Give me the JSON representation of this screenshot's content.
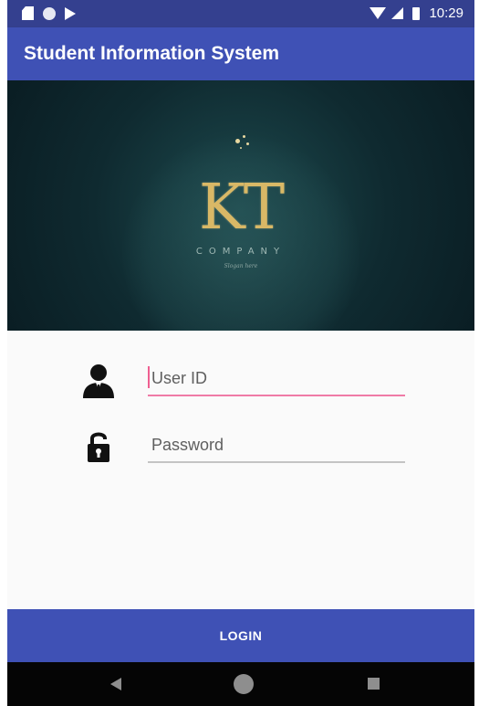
{
  "status_bar": {
    "time": "10:29",
    "icons": [
      "sd-card-icon",
      "circle-notification-icon",
      "play-store-icon",
      "wifi-icon",
      "cell-signal-icon",
      "battery-icon"
    ]
  },
  "app_bar": {
    "title": "Student Information System",
    "color": "#3f51b5"
  },
  "banner": {
    "logo_text": "KT",
    "company_text": "COMPANY",
    "slogan_text": "Slogan here",
    "logo_color": "#d9b866",
    "background_color": "#0f2a30"
  },
  "form": {
    "user_id": {
      "icon": "person-icon",
      "placeholder": "User ID",
      "value": "",
      "focused": true
    },
    "password": {
      "icon": "lock-icon",
      "placeholder": "Password",
      "value": ""
    }
  },
  "login_button": {
    "label": "LOGIN"
  },
  "nav_bar": {
    "icons": [
      "back-icon",
      "home-icon",
      "recents-icon"
    ]
  },
  "colors": {
    "primary": "#3f51b5",
    "primary_dark": "#34408f",
    "accent": "#ef5f90"
  }
}
